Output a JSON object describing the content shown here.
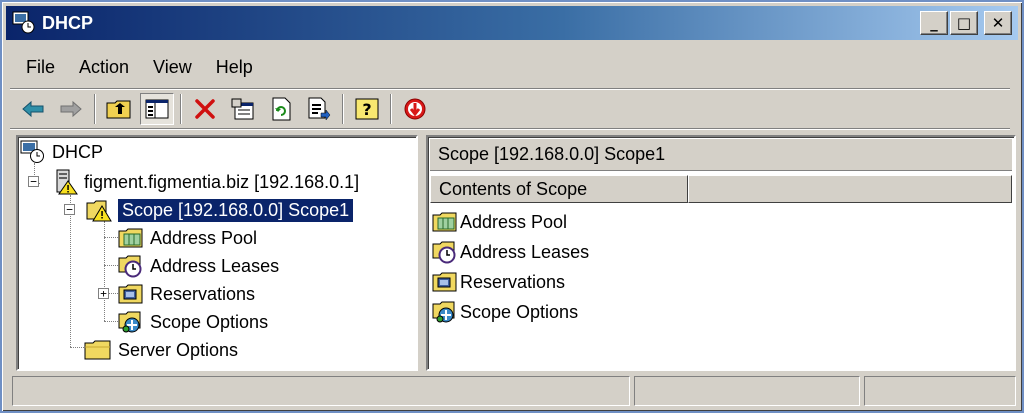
{
  "window": {
    "title": "DHCP",
    "controls": {
      "minimize": "_",
      "maximize": "□",
      "close": "✕"
    }
  },
  "menubar": {
    "items": [
      {
        "label": "File"
      },
      {
        "label": "Action"
      },
      {
        "label": "View"
      },
      {
        "label": "Help"
      }
    ]
  },
  "toolbar": {
    "buttons": [
      {
        "icon": "back-arrow-icon"
      },
      {
        "icon": "forward-arrow-icon"
      },
      {
        "icon": "up-folder-icon"
      },
      {
        "icon": "show-hide-tree-icon"
      },
      {
        "icon": "delete-icon"
      },
      {
        "icon": "properties-icon"
      },
      {
        "icon": "refresh-icon"
      },
      {
        "icon": "export-list-icon"
      },
      {
        "icon": "help-icon"
      },
      {
        "icon": "deactivate-scope-icon"
      }
    ]
  },
  "tree": {
    "root": "DHCP",
    "server": "figment.figmentia.biz [192.168.0.1]",
    "scope": "Scope [192.168.0.0] Scope1",
    "scope_children": [
      "Address Pool",
      "Address Leases",
      "Reservations",
      "Scope Options"
    ],
    "server_options": "Server Options"
  },
  "right_pane": {
    "header": "Scope [192.168.0.0] Scope1",
    "column_header": "Contents of Scope",
    "items": [
      "Address Pool",
      "Address Leases",
      "Reservations",
      "Scope Options"
    ]
  },
  "statusbar": {
    "panels": [
      "",
      "",
      ""
    ]
  },
  "colors": {
    "title_gradient_start": "#0a246a",
    "title_gradient_end": "#a6caf0",
    "chrome": "#d4d0c8",
    "selection": "#0a246a"
  }
}
